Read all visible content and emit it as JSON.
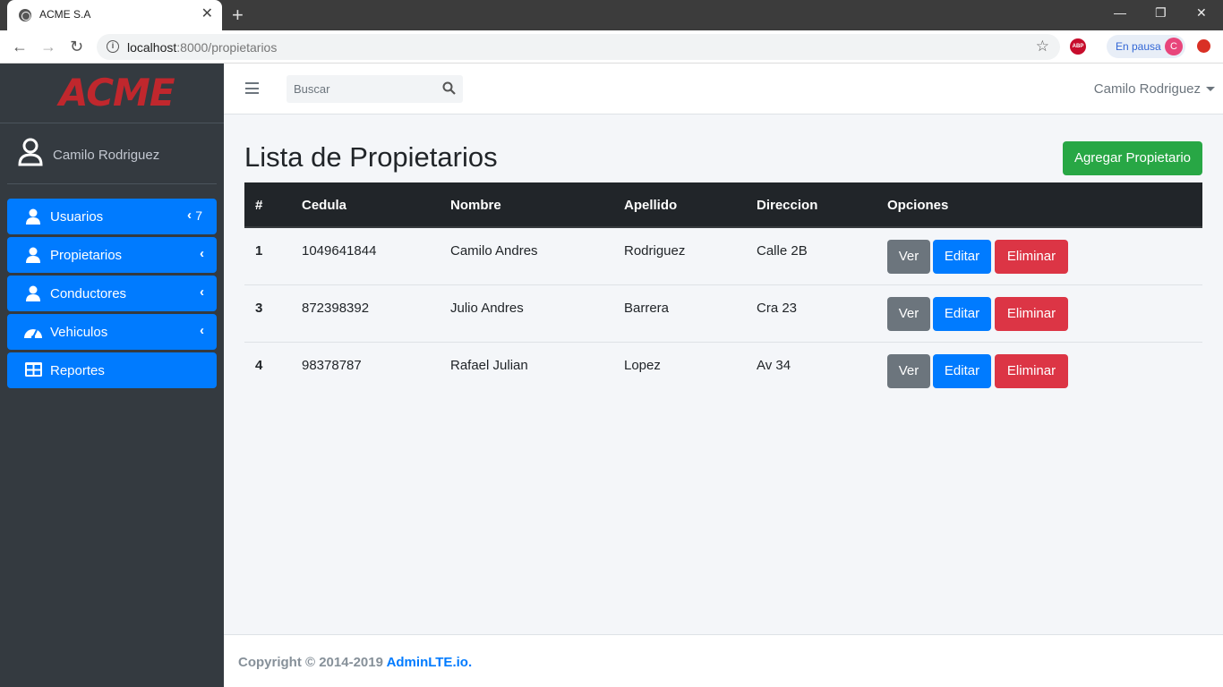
{
  "browser": {
    "tab_title": "ACME S.A",
    "tab_close": "✕",
    "new_tab": "+",
    "url_host": "localhost",
    "url_path": ":8000/propietarios",
    "abp_label": "ABP",
    "profile_status": "En pausa",
    "profile_initial": "C",
    "win_minimize": "—",
    "win_restore": "❐",
    "win_close": "✕",
    "back": "←",
    "forward": "→",
    "reload": "↻",
    "star": "☆"
  },
  "sidebar": {
    "brand": "ACME",
    "user_name": "Camilo Rodriguez",
    "items": [
      {
        "label": "Usuarios",
        "icon": "user-icon",
        "badge": "7",
        "chevron": "‹"
      },
      {
        "label": "Propietarios",
        "icon": "user-icon",
        "chevron": "‹"
      },
      {
        "label": "Conductores",
        "icon": "user-icon",
        "chevron": "‹"
      },
      {
        "label": "Vehiculos",
        "icon": "tachometer-icon",
        "chevron": "‹"
      },
      {
        "label": "Reportes",
        "icon": "table-icon"
      }
    ]
  },
  "navbar": {
    "search_placeholder": "Buscar",
    "user": "Camilo Rodriguez"
  },
  "content": {
    "title": "Lista de Propietarios",
    "add_button": "Agregar Propietario"
  },
  "table": {
    "headers": [
      "#",
      "Cedula",
      "Nombre",
      "Apellido",
      "Direccion",
      "Opciones"
    ],
    "rows": [
      {
        "id": "1",
        "cedula": "1049641844",
        "nombre": "Camilo Andres",
        "apellido": "Rodriguez",
        "direccion": "Calle 2B"
      },
      {
        "id": "3",
        "cedula": "872398392",
        "nombre": "Julio Andres",
        "apellido": "Barrera",
        "direccion": "Cra 23"
      },
      {
        "id": "4",
        "cedula": "98378787",
        "nombre": "Rafael Julian",
        "apellido": "Lopez",
        "direccion": "Av 34"
      }
    ],
    "btn_view": "Ver",
    "btn_edit": "Editar",
    "btn_delete": "Eliminar"
  },
  "footer": {
    "text": "Copyright © 2014-2019 ",
    "link": "AdminLTE.io."
  },
  "colors": {
    "primary": "#007bff",
    "success": "#28a745",
    "danger": "#dc3545",
    "secondary": "#6c757d",
    "sidebar_bg": "#343a40",
    "brand_red": "#c0272d"
  }
}
